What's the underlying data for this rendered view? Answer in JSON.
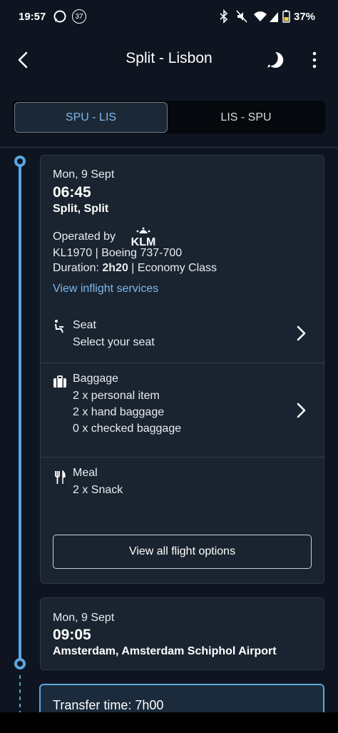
{
  "status_bar": {
    "time": "19:57",
    "notif_badge": "37",
    "battery": "37%"
  },
  "header": {
    "title": "Split - Lisbon"
  },
  "segments": [
    {
      "label": "SPU - LIS",
      "selected": true
    },
    {
      "label": "LIS - SPU",
      "selected": false
    }
  ],
  "departure": {
    "date": "Mon, 9 Sept",
    "time": "06:45",
    "place": "Split, Split",
    "operated_by_label": "Operated by",
    "airline_logo_text": "KLM",
    "flight_line": "KL1970 | Boeing 737-700",
    "duration_label": "Duration: ",
    "duration_value": "2h20",
    "class_text": " | Economy Class",
    "inflight_link": "View inflight services"
  },
  "options": {
    "seat": {
      "title": "Seat",
      "lines": [
        "Select your seat"
      ]
    },
    "baggage": {
      "title": "Baggage",
      "lines": [
        "2 x personal item",
        "2 x hand baggage",
        "0 x checked baggage"
      ]
    },
    "meal": {
      "title": "Meal",
      "lines": [
        "2 x Snack"
      ]
    },
    "all_options_button": "View all flight options"
  },
  "arrival": {
    "date": "Mon, 9 Sept",
    "time": "09:05",
    "place": "Amsterdam, Amsterdam Schiphol Airport"
  },
  "transfer": {
    "text": "Transfer time: 7h00"
  },
  "colors": {
    "background": "#0e1520",
    "card": "#1a2430",
    "accent": "#5aa6e0",
    "link": "#7fb8ee"
  }
}
